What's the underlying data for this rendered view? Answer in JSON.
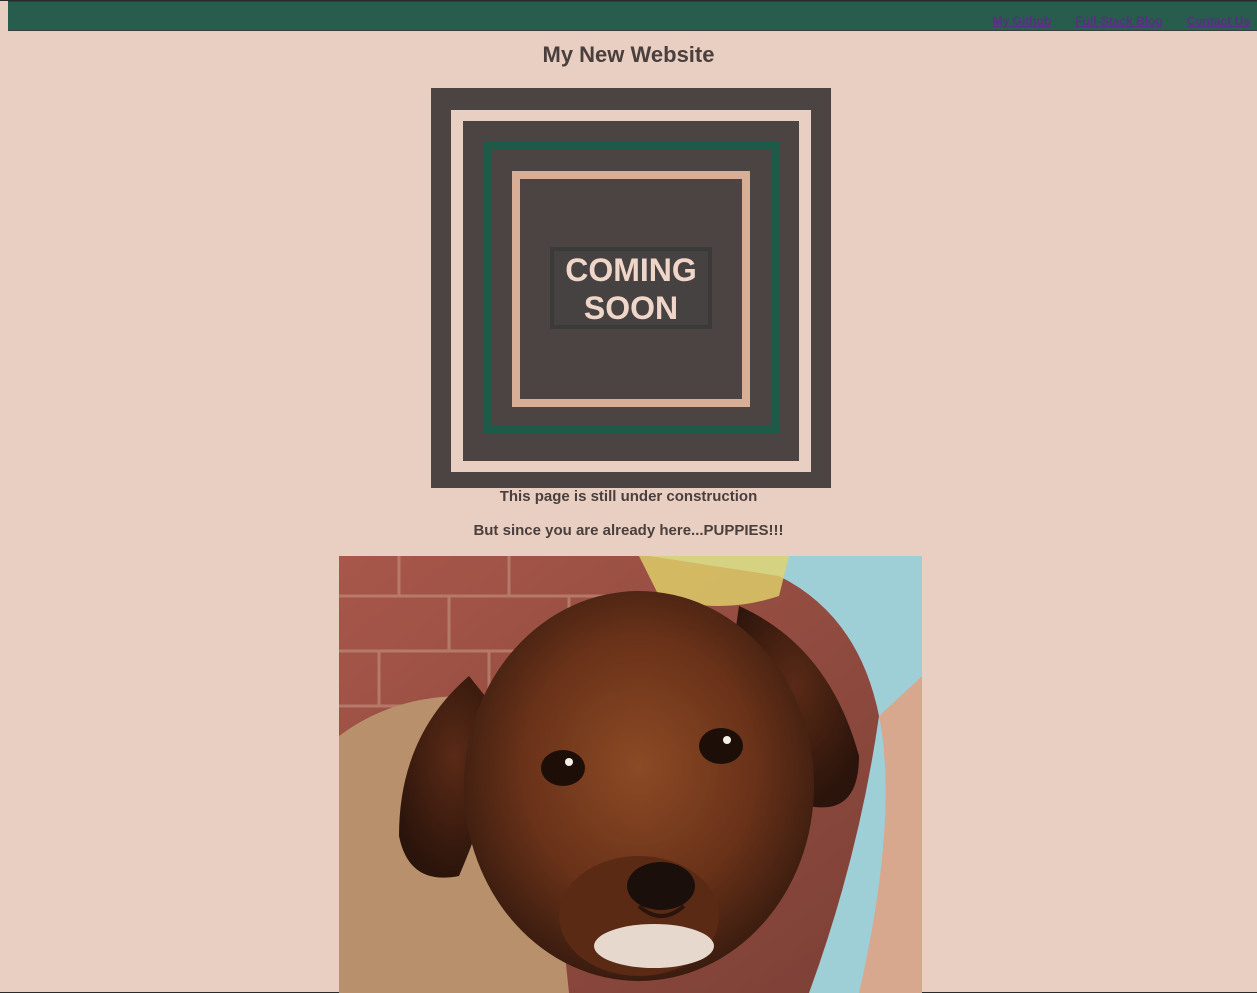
{
  "nav": {
    "links": [
      "My Github",
      "Full-Stack Blog",
      "Contact Us"
    ]
  },
  "page_title": "My New Website",
  "coming_soon_image": {
    "line1": "COMING",
    "line2": "SOON"
  },
  "text": {
    "construction": "This page is still under construction",
    "puppies": "But since you are already here...PUPPIES!!!"
  },
  "colors": {
    "background": "#e8cfc1",
    "navbar": "#285c4d",
    "text": "#4a3f3d",
    "link": "#5a2d86"
  }
}
